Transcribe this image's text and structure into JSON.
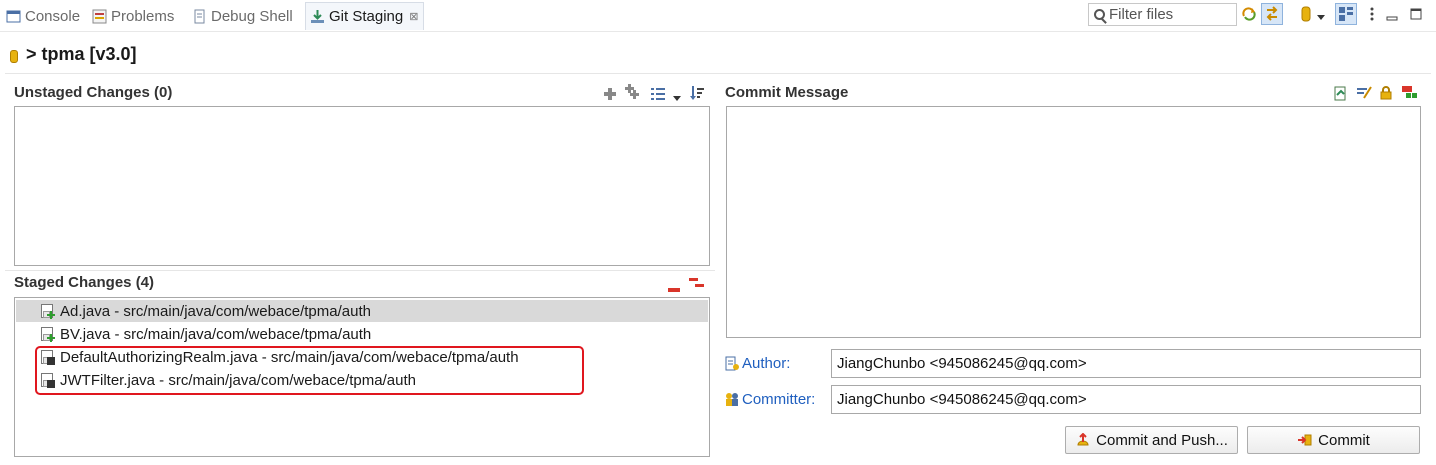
{
  "tabs": [
    {
      "label": "Console",
      "icon": "console-icon"
    },
    {
      "label": "Problems",
      "icon": "problems-icon"
    },
    {
      "label": "Debug Shell",
      "icon": "debug-shell-icon"
    },
    {
      "label": "Git Staging",
      "icon": "git-staging-icon",
      "active": true,
      "close": "⊠"
    }
  ],
  "filter": {
    "placeholder": "Filter files"
  },
  "repo": {
    "title": "> tpma [v3.0]"
  },
  "unstaged": {
    "title": "Unstaged Changes (0)",
    "items": []
  },
  "staged": {
    "title": "Staged Changes (4)",
    "items": [
      {
        "label": "Ad.java - src/main/java/com/webace/tpma/auth",
        "status": "added",
        "selected": true
      },
      {
        "label": "BV.java - src/main/java/com/webace/tpma/auth",
        "status": "added"
      },
      {
        "label": "DefaultAuthorizingRealm.java - src/main/java/com/webace/tpma/auth",
        "status": "modified"
      },
      {
        "label": "JWTFilter.java - src/main/java/com/webace/tpma/auth",
        "status": "modified"
      }
    ]
  },
  "commit": {
    "title": "Commit Message",
    "message": "",
    "author_label": "Author:",
    "author_value": "JiangChunbo <945086245@qq.com>",
    "committer_label": "Committer:",
    "committer_value": "JiangChunbo <945086245@qq.com>",
    "commit_push_label": "Commit and Push...",
    "commit_label": "Commit"
  },
  "colors": {
    "highlight": "#e0161e",
    "link_label": "#1f5fbf",
    "selected_row": "#d9d9d9"
  }
}
